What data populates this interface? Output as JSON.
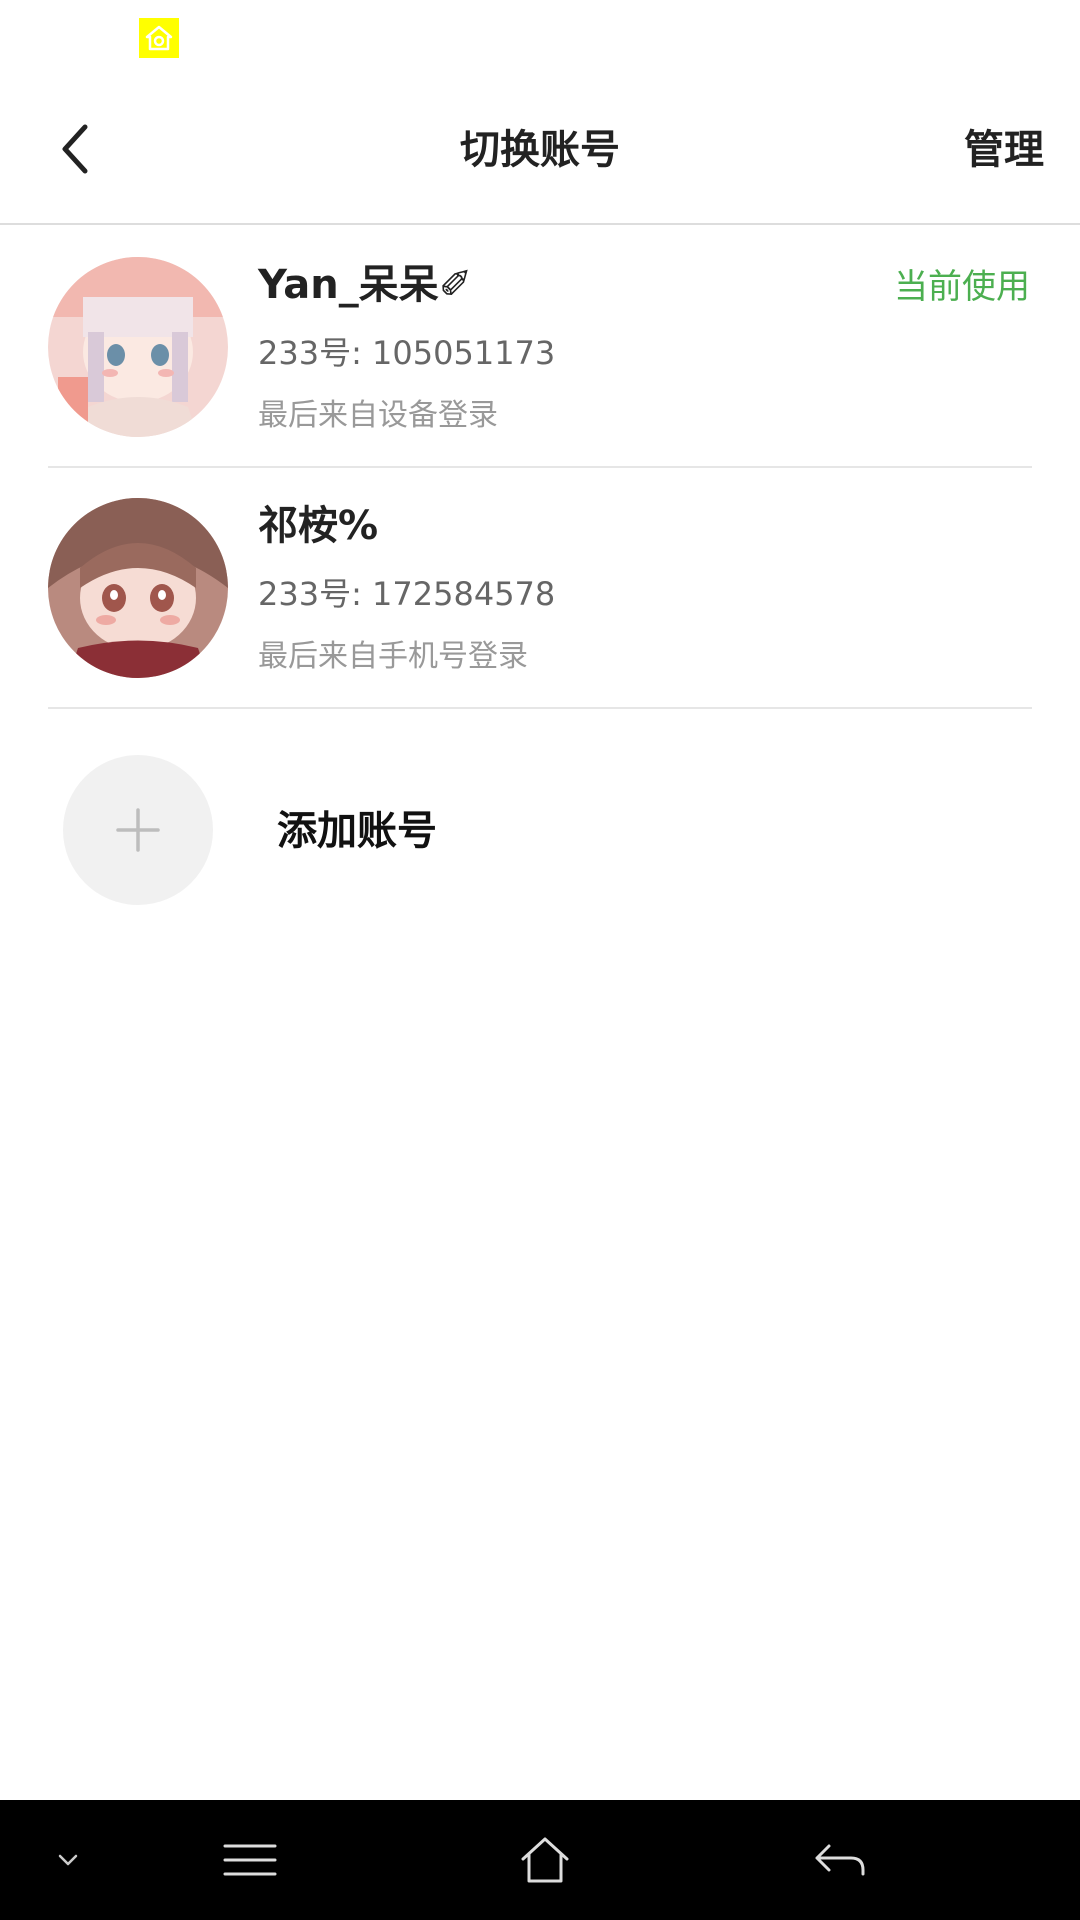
{
  "nav": {
    "title": "切换账号",
    "manage_label": "管理"
  },
  "accounts": [
    {
      "name": "Yan_呆呆✐",
      "id_text": "233号: 105051173",
      "login_text": "最后来自设备登录",
      "current_label": "当前使用"
    },
    {
      "name": "祁桉%",
      "id_text": "233号: 172584578",
      "login_text": "最后来自手机号登录"
    }
  ],
  "add_account": {
    "label": "添加账号"
  },
  "icons": {
    "status_app": "app-notification-icon",
    "back": "chevron-left-icon",
    "add": "plus-icon",
    "collapse": "chevron-down-icon",
    "menu": "menu-icon",
    "home": "home-icon",
    "system_back": "back-arrow-icon"
  },
  "colors": {
    "accent_green": "#4caf50",
    "divider": "#e6e6e6",
    "system_bar": "#000000"
  }
}
